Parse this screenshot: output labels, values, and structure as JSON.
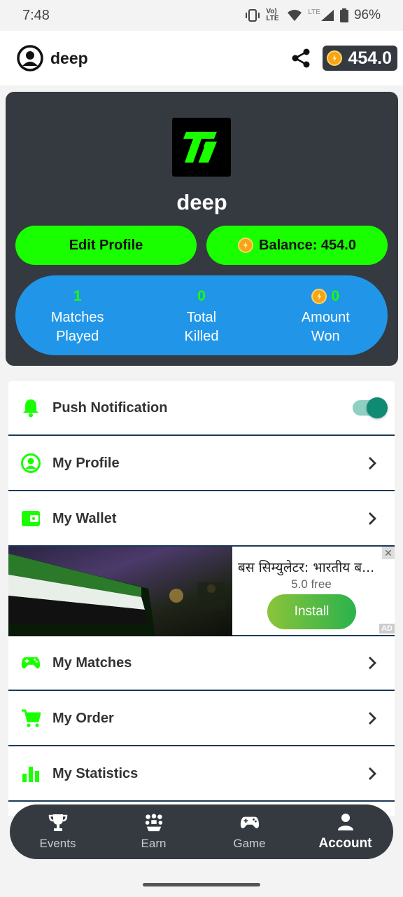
{
  "status_bar": {
    "time": "7:48",
    "network": "Vo) LTE",
    "lte": "LTE",
    "battery": "96%"
  },
  "app_bar": {
    "username": "deep",
    "coins": "454.0"
  },
  "profile": {
    "name": "deep",
    "edit_label": "Edit Profile",
    "balance_label": "Balance: 454.0",
    "stats": [
      {
        "value": "1",
        "label_line1": "Matches",
        "label_line2": "Played"
      },
      {
        "value": "0",
        "label_line1": "Total",
        "label_line2": "Killed"
      },
      {
        "value": "0",
        "label_line1": "Amount",
        "label_line2": "Won"
      }
    ]
  },
  "menu": {
    "push_notification": "Push Notification",
    "my_profile": "My Profile",
    "my_wallet": "My Wallet",
    "my_matches": "My Matches",
    "my_order": "My Order",
    "my_statistics": "My Statistics"
  },
  "ad": {
    "title": "बस सिम्युलेटर: भारतीय ब...",
    "rating": "5.0 free",
    "install": "Install",
    "close": "✕",
    "badge": "AD"
  },
  "bottom_nav": [
    {
      "label": "Events",
      "icon": "trophy-icon"
    },
    {
      "label": "Earn",
      "icon": "gift-tree-icon"
    },
    {
      "label": "Game",
      "icon": "gamepad-icon"
    },
    {
      "label": "Account",
      "icon": "person-icon"
    }
  ],
  "colors": {
    "accent": "#1aff00",
    "card_dark": "#353a41",
    "stats_blue": "#2196e9",
    "divider": "#1d3a57"
  }
}
